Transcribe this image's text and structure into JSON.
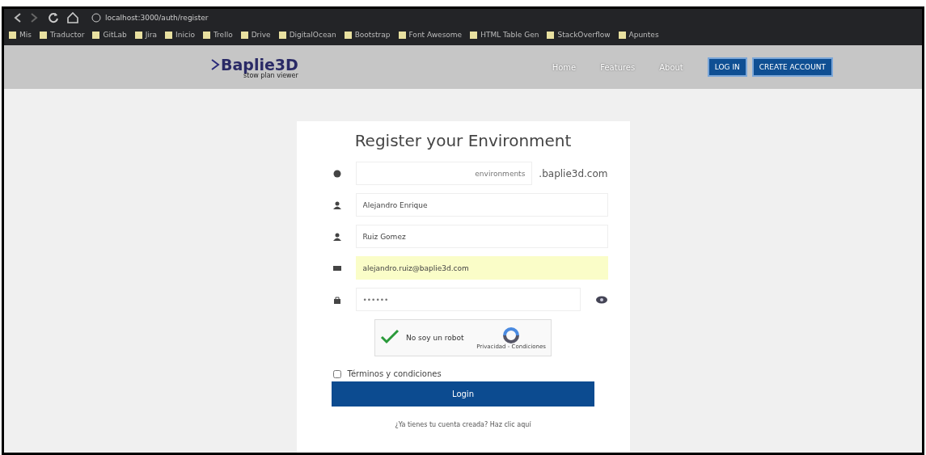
{
  "browser": {
    "address": "localhost:3000/auth/register",
    "bookmarks": [
      {
        "label": "Mis"
      },
      {
        "label": "Traductor"
      },
      {
        "label": "GitLab"
      },
      {
        "label": "Jira"
      },
      {
        "label": "Inicio"
      },
      {
        "label": "Trello"
      },
      {
        "label": "Drive"
      },
      {
        "label": "DigitalOcean"
      },
      {
        "label": "Bootstrap"
      },
      {
        "label": "Font Awesome"
      },
      {
        "label": "HTML Table Gen"
      },
      {
        "label": "StackOverflow"
      },
      {
        "label": "Apuntes"
      }
    ]
  },
  "navbar": {
    "logo": "Baplie3D",
    "tagline": "stow plan viewer",
    "links": [
      {
        "label": "Home"
      },
      {
        "label": "Features"
      },
      {
        "label": "About"
      }
    ],
    "buttons": [
      {
        "label": "LOG IN"
      },
      {
        "label": "CREATE ACCOUNT"
      }
    ]
  },
  "form": {
    "title": "Register your Environment",
    "fields": [
      {
        "kind": "domain",
        "placeholder": "environments",
        "suffix": ".baplie3d.com"
      },
      {
        "kind": "name",
        "value": "Alejandro Enrique"
      },
      {
        "kind": "name",
        "value": "Ruiz Gomez"
      },
      {
        "kind": "email",
        "value": "alejandro.ruiz@baplie3d.com",
        "autofilled": true
      },
      {
        "kind": "password",
        "placeholder": "••••••"
      }
    ],
    "captcha": {
      "label": "No soy un robot",
      "checked": true,
      "footer": "Privacidad - Condiciones"
    },
    "terms": {
      "label": "Términos y condiciones",
      "checked": false
    },
    "submit": "Login",
    "footer": "¿Ya tienes tu cuenta creada? Haz clic aquí"
  }
}
